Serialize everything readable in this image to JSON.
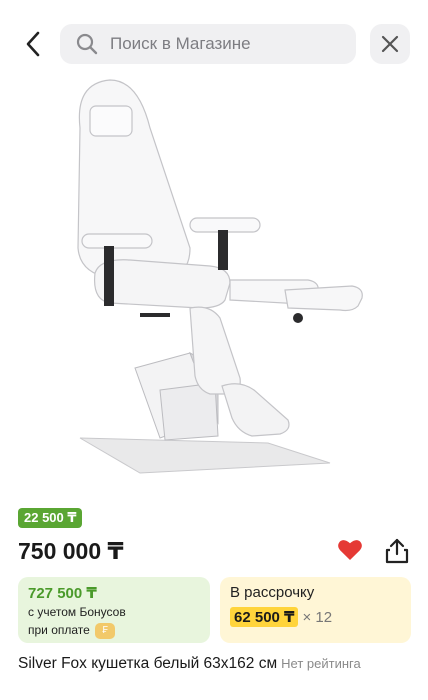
{
  "search": {
    "placeholder": "Поиск в Магазине"
  },
  "icons": {
    "back": "chevron-left-icon",
    "search": "search-icon",
    "close": "close-icon",
    "favorite": "heart-icon",
    "share": "share-icon",
    "bonus_coin": "bonus-coin-icon"
  },
  "product": {
    "image": "white pedicure/cosmetology chair with headrest, armrests and split leg rest on square base",
    "bonus_badge": "22 500 ₸",
    "price": "750 000 ₸",
    "favorited": true,
    "title": "Silver Fox кушетка белый 63x162 см",
    "rating_text": "Нет рейтинга"
  },
  "bonus_offer": {
    "price": "727 500 ₸",
    "note_line1": "с учетом Бонусов",
    "note_line2": "при оплате"
  },
  "installment": {
    "title": "В рассрочку",
    "monthly": "62 500 ₸",
    "multiplier": "× 12"
  },
  "colors": {
    "accent_green": "#5aa633",
    "bonus_bg": "#e8f5dd",
    "installment_bg": "#fff6d6",
    "installment_price_bg": "#ffd43b",
    "heart": "#e53935"
  }
}
